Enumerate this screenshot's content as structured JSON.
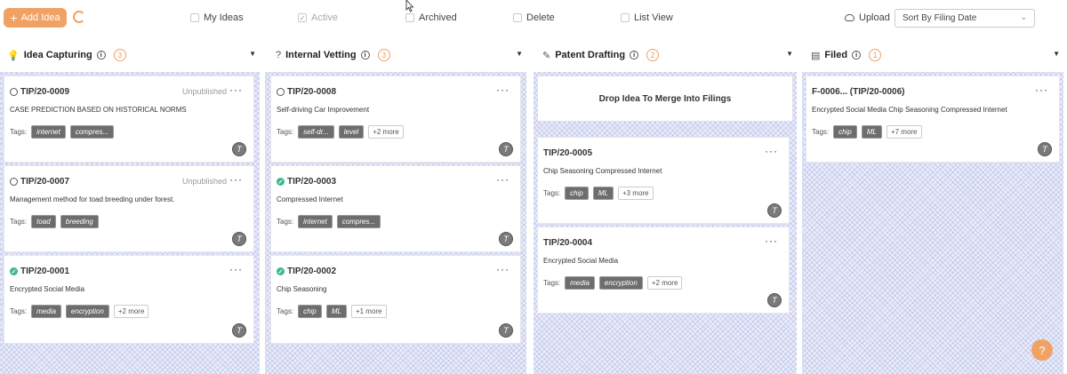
{
  "toolbar": {
    "add_label": "Add Idea",
    "filters": [
      {
        "label": "My Ideas",
        "checked": false,
        "disabled": false
      },
      {
        "label": "Active",
        "checked": true,
        "disabled": true
      },
      {
        "label": "Archived",
        "checked": false,
        "disabled": false
      },
      {
        "label": "Delete",
        "checked": false,
        "disabled": false
      },
      {
        "label": "List View",
        "checked": false,
        "disabled": false
      }
    ],
    "upload_label": "Upload",
    "sort_value": "Sort By Filing Date"
  },
  "columns": [
    {
      "title": "Idea Capturing",
      "icon": "bulb-icon",
      "count": "3",
      "cards": [
        {
          "id": "TIP/20-0009",
          "status": "Unpublished",
          "state": "clock",
          "title": "CASE PREDICTION BASED ON HISTORICAL NORMS",
          "tags_label": "Tags:",
          "tags": [
            "internet",
            "compres..."
          ],
          "more": "",
          "avatar": "T"
        },
        {
          "id": "TIP/20-0007",
          "status": "Unpublished",
          "state": "clock",
          "title": "Management method for toad breeding under forest.",
          "tags_label": "Tags:",
          "tags": [
            "toad",
            "breeding"
          ],
          "more": "",
          "avatar": "T"
        },
        {
          "id": "TIP/20-0001",
          "status": "",
          "state": "check",
          "title": "Encrypted Social Media",
          "tags_label": "Tags:",
          "tags": [
            "media",
            "encryption"
          ],
          "more": "+2 more",
          "avatar": "T"
        }
      ]
    },
    {
      "title": "Internal Vetting",
      "icon": "question-icon",
      "count": "3",
      "cards": [
        {
          "id": "TIP/20-0008",
          "status": "",
          "state": "clock",
          "title": "Self-driving Car Improvement",
          "tags_label": "Tags:",
          "tags": [
            "self-dr...",
            "level"
          ],
          "more": "+2 more",
          "avatar": "T"
        },
        {
          "id": "TIP/20-0003",
          "status": "",
          "state": "check",
          "title": "Compressed Internet",
          "tags_label": "Tags:",
          "tags": [
            "internet",
            "compres..."
          ],
          "more": "",
          "avatar": "T"
        },
        {
          "id": "TIP/20-0002",
          "status": "",
          "state": "check",
          "title": "Chip Seasoning",
          "tags_label": "Tags:",
          "tags": [
            "chip",
            "ML"
          ],
          "more": "+1 more",
          "avatar": "T"
        }
      ]
    },
    {
      "title": "Patent Drafting",
      "icon": "pen-icon",
      "count": "2",
      "dropzone": "Drop Idea To Merge Into Filings",
      "cards": [
        {
          "id": "TIP/20-0005",
          "status": "",
          "state": "none",
          "title": "Chip Seasoning Compressed Internet",
          "tags_label": "Tags:",
          "tags": [
            "chip",
            "ML"
          ],
          "more": "+3 more",
          "avatar": "T"
        },
        {
          "id": "TIP/20-0004",
          "status": "",
          "state": "none",
          "title": "Encrypted Social Media",
          "tags_label": "Tags:",
          "tags": [
            "media",
            "encryption"
          ],
          "more": "+2 more",
          "avatar": "T"
        }
      ]
    },
    {
      "title": "Filed",
      "icon": "folder-icon",
      "count": "1",
      "cards": [
        {
          "id": "F-0006... (TIP/20-0006)",
          "status": "",
          "state": "none",
          "title": "Encrypted Social Media Chip Seasoning Compressed Internet",
          "tags_label": "Tags:",
          "tags": [
            "chip",
            "ML"
          ],
          "more": "+7 more",
          "avatar": "T"
        }
      ]
    }
  ],
  "help_label": "?"
}
